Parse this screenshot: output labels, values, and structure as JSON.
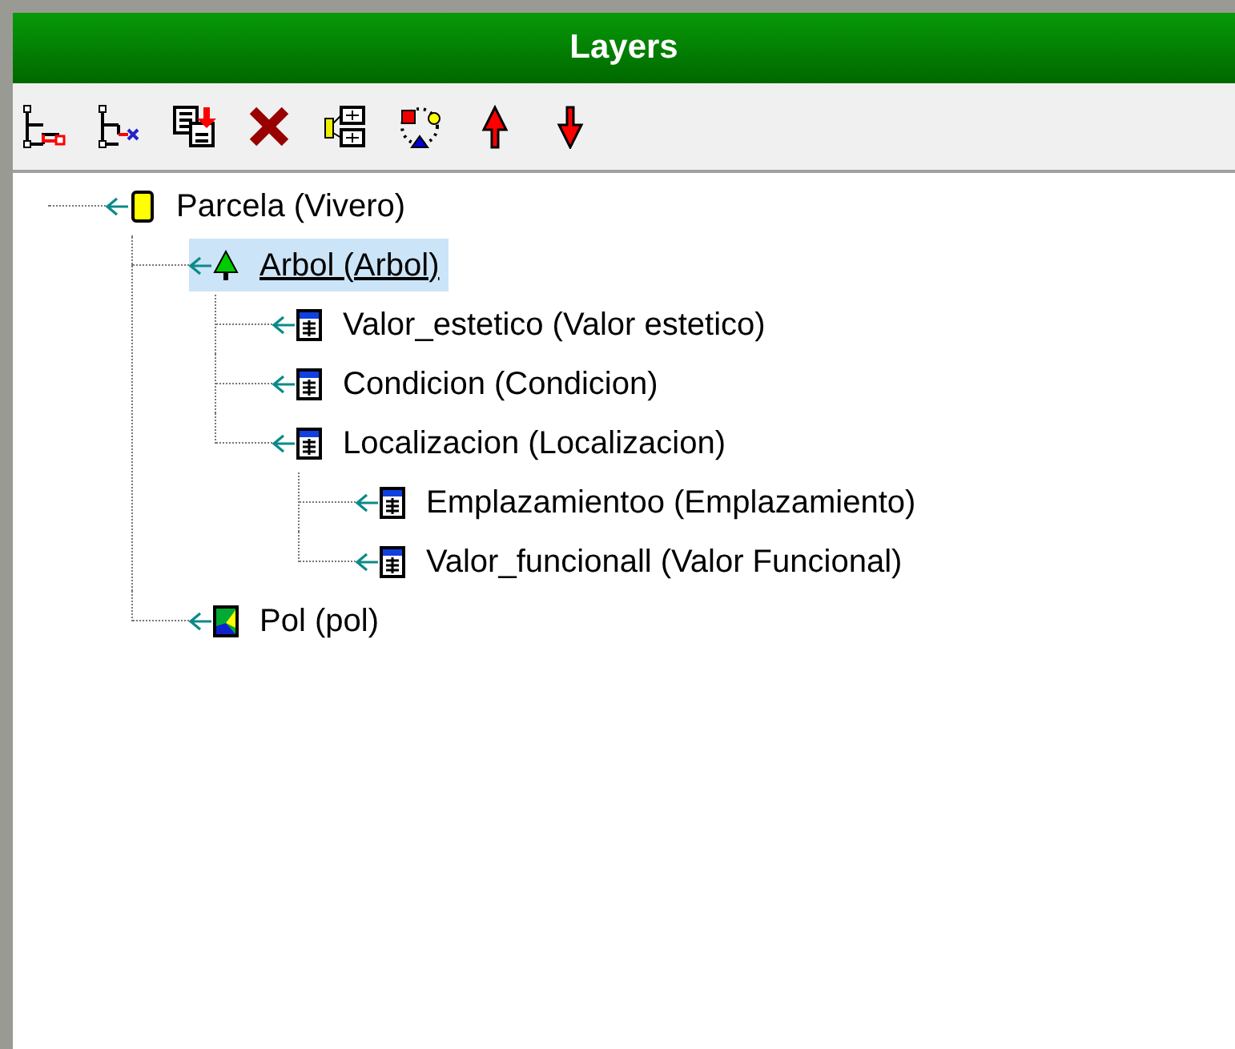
{
  "panel": {
    "title": "Layers"
  },
  "toolbar": [
    {
      "kind": "add-link"
    },
    {
      "kind": "remove-link"
    },
    {
      "kind": "copy"
    },
    {
      "kind": "delete"
    },
    {
      "kind": "structure"
    },
    {
      "kind": "cycle"
    },
    {
      "kind": "up"
    },
    {
      "kind": "down"
    }
  ],
  "tree": [
    {
      "label": "Parcela (Vivero)",
      "kind": "layer",
      "selected": false,
      "children": [
        {
          "label": "Arbol (Arbol)",
          "kind": "tree",
          "selected": true,
          "children": [
            {
              "label": "Valor_estetico (Valor estetico)",
              "kind": "table",
              "selected": false
            },
            {
              "label": "Condicion (Condicion)",
              "kind": "table",
              "selected": false
            },
            {
              "label": "Localizacion (Localizacion)",
              "kind": "table",
              "selected": false,
              "children": [
                {
                  "label": "Emplazamientoo (Emplazamiento)",
                  "kind": "table",
                  "selected": false
                },
                {
                  "label": "Valor_funcionall (Valor Funcional)",
                  "kind": "table",
                  "selected": false
                }
              ]
            }
          ]
        },
        {
          "label": "Pol (pol)",
          "kind": "polygon",
          "selected": false
        }
      ]
    }
  ]
}
